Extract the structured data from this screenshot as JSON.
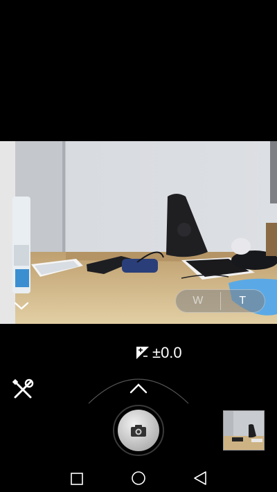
{
  "viewfinder": {
    "scene": "camera-preview"
  },
  "zoom": {
    "wide_label": "W",
    "tele_label": "T",
    "selected": "T"
  },
  "exposure": {
    "icon": "exposure-icon",
    "value": "±0.0"
  },
  "controls": {
    "collapse_icon": "chevron-down-icon",
    "tools_icon": "tools-icon",
    "mode_chevron_icon": "chevron-up-icon",
    "shutter_icon": "camera-icon"
  },
  "gallery": {
    "thumbnail": "last-photo-thumbnail"
  },
  "navbar": {
    "back_icon": "back-icon",
    "home_icon": "home-icon",
    "recents_icon": "recents-icon"
  }
}
